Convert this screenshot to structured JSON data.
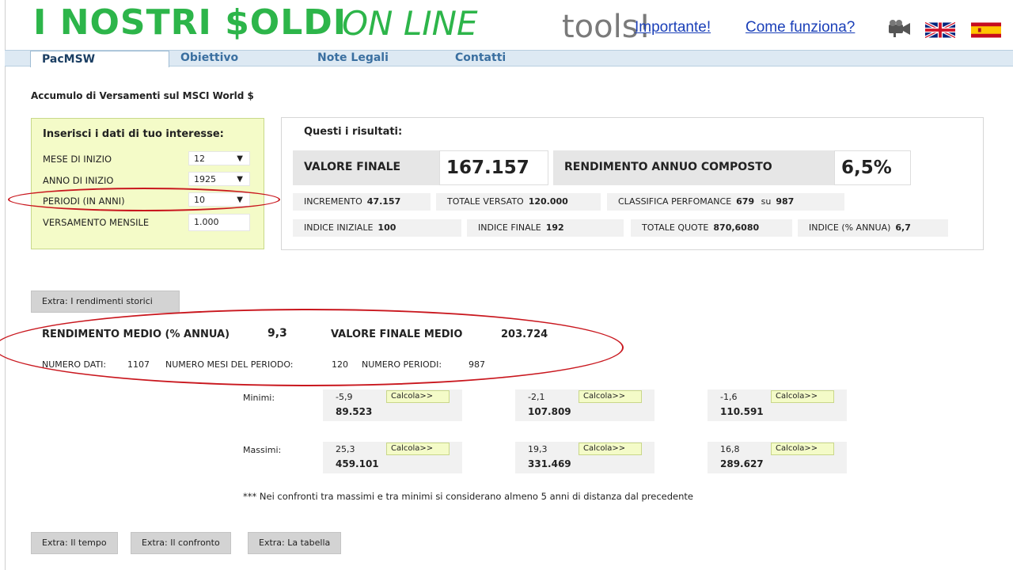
{
  "header": {
    "brand_bold": "I NOSTRI $OLDI",
    "brand_light": "ON LINE",
    "brand_tools": "tools!",
    "links": [
      "Importante!",
      "Come funziona?"
    ],
    "icons": [
      "camera-icon",
      "uk-flag-icon",
      "spain-flag-icon"
    ]
  },
  "tabs": [
    "PacMSW",
    "Obiettivo",
    "Note Legali",
    "Contatti"
  ],
  "subtitle": "Accumulo di Versamenti sul MSCI World $",
  "input_panel": {
    "title": "Inserisci i dati di tuo interesse:",
    "fields": [
      {
        "label": "MESE DI INIZIO",
        "value": "12"
      },
      {
        "label": "ANNO DI INIZIO",
        "value": "1925"
      },
      {
        "label": "PERIODI (IN ANNI)",
        "value": "10"
      },
      {
        "label": "VERSAMENTO MENSILE",
        "value": "1.000"
      }
    ]
  },
  "results": {
    "title": "Questi i risultati:",
    "valore_finale_label": "VALORE FINALE",
    "valore_finale": "167.157",
    "rendimento_label": "RENDIMENTO ANNUO COMPOSTO",
    "rendimento": "6,5%",
    "row1": [
      {
        "label": "INCREMENTO",
        "value": "47.157"
      },
      {
        "label": "TOTALE VERSATO",
        "value": "120.000"
      },
      {
        "label": "CLASSIFICA PERFOMANCE",
        "value": "679",
        "su": "su",
        "total": "987"
      }
    ],
    "row2": [
      {
        "label": "INDICE INIZIALE",
        "value": "100"
      },
      {
        "label": "INDICE FINALE",
        "value": "192"
      },
      {
        "label": "TOTALE QUOTE",
        "value": "870,6080"
      },
      {
        "label": "INDICE (% ANNUA)",
        "value": "6,7"
      }
    ]
  },
  "extra_storici": "Extra: I rendimenti storici",
  "storici": {
    "rend_medio_label": "RENDIMENTO MEDIO (% ANNUA)",
    "rend_medio": "9,3",
    "valore_medio_label": "VALORE FINALE MEDIO",
    "valore_medio": "203.724",
    "numero_dati_label": "NUMERO DATI:",
    "numero_dati": "1107",
    "numero_mesi_label": "NUMERO MESI DEL PERIODO:",
    "numero_mesi": "120",
    "numero_periodi_label": "NUMERO PERIODI:",
    "numero_periodi": "987"
  },
  "minimi_label": "Minimi:",
  "massimi_label": "Massimi:",
  "calcola": "Calcola>>",
  "minimi": [
    {
      "pct": "-5,9",
      "amount": "89.523"
    },
    {
      "pct": "-2,1",
      "amount": "107.809"
    },
    {
      "pct": "-1,6",
      "amount": "110.591"
    }
  ],
  "massimi": [
    {
      "pct": "25,3",
      "amount": "459.101"
    },
    {
      "pct": "19,3",
      "amount": "331.469"
    },
    {
      "pct": "16,8",
      "amount": "289.627"
    }
  ],
  "note": "*** Nei confronti tra massimi e tra minimi si considerano almeno 5 anni di distanza dal precedente",
  "bottom_buttons": [
    "Extra: Il tempo",
    "Extra: Il confronto",
    "Extra: La tabella"
  ]
}
